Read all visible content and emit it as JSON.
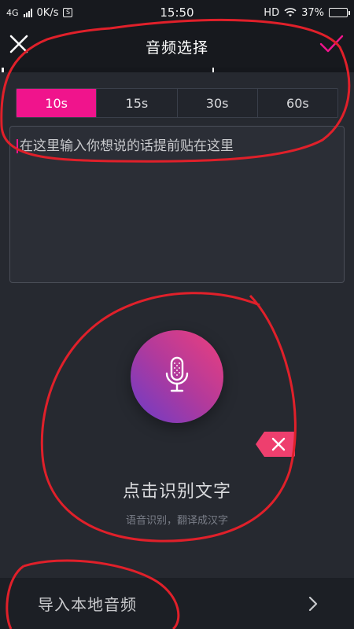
{
  "status_bar": {
    "network": "4G",
    "speed": "0K/s",
    "s_badge": "S",
    "time": "15:50",
    "hd": "HD",
    "battery": "37%",
    "battery_level": 0.37
  },
  "header": {
    "title": "音频选择",
    "close_icon": "close-icon",
    "confirm_icon": "check-icon"
  },
  "duration_tabs": [
    {
      "label": "10s",
      "active": true
    },
    {
      "label": "15s",
      "active": false
    },
    {
      "label": "30s",
      "active": false
    },
    {
      "label": "60s",
      "active": false
    }
  ],
  "text_input": {
    "placeholder": "在这里输入你想说的话提前贴在这里"
  },
  "mic": {
    "icon": "microphone-icon",
    "label": "点击识别文字",
    "hint": "语音识别，翻译成汉字"
  },
  "import": {
    "label": "导入本地音频",
    "icon": "chevron-right-icon"
  },
  "colors": {
    "accent": "#f0148c",
    "background": "#262930",
    "annotation": "#e0202a"
  }
}
